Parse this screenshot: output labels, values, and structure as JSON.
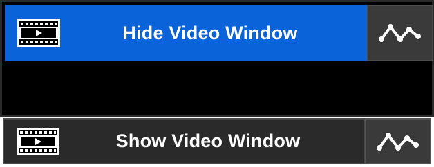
{
  "top": {
    "button_label": "Hide Video Window",
    "button_color": "#0a63d8",
    "video_icon": "film-icon",
    "side_icon": "waveform-icon"
  },
  "bottom": {
    "button_label": "Show Video Window",
    "button_color": "#2a2a2a",
    "video_icon": "film-icon",
    "side_icon": "waveform-icon"
  }
}
